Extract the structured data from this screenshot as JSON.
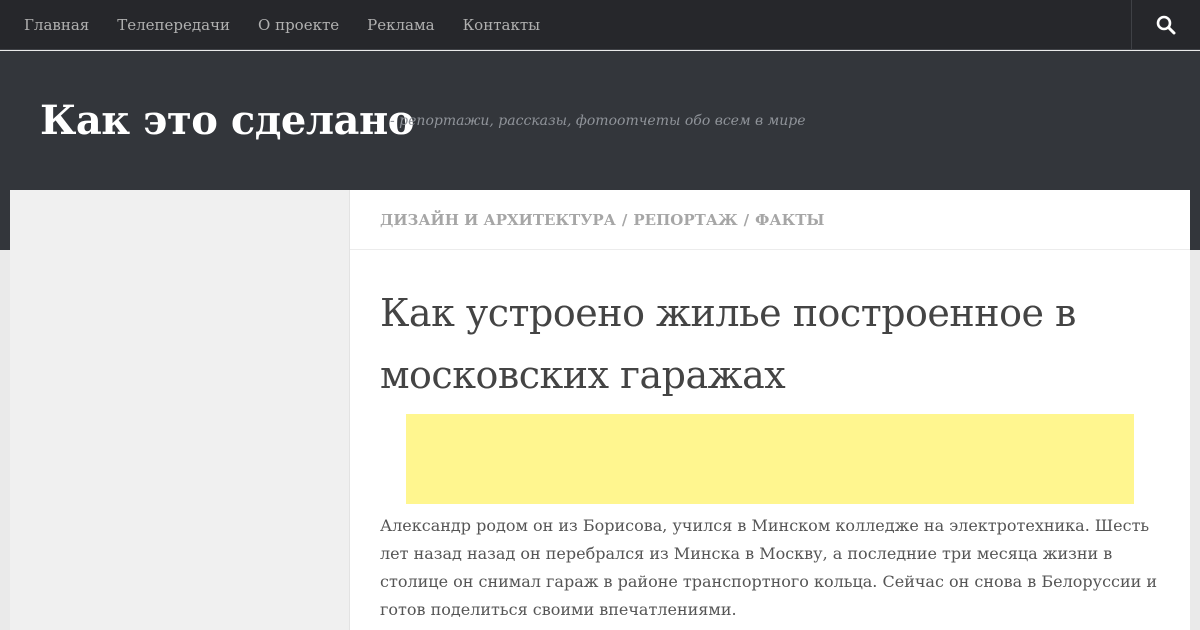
{
  "nav": {
    "items": [
      {
        "label": "Главная"
      },
      {
        "label": "Телепередачи"
      },
      {
        "label": "О проекте"
      },
      {
        "label": "Реклама"
      },
      {
        "label": "Контакты"
      }
    ],
    "search_icon": "search-icon"
  },
  "header": {
    "title": "Как это сделано",
    "tagline": "- репортажи, рассказы, фотоотчеты обо всем в мире"
  },
  "breadcrumbs": {
    "items": [
      {
        "label": "Дизайн и архитектура"
      },
      {
        "label": "Репортаж"
      },
      {
        "label": "Факты"
      }
    ],
    "separator": "/"
  },
  "post": {
    "title": "Как устроено жилье построенное в московских гаражах",
    "body": "Александр родом он из Борисова, учился в Минском колледже на электротехника. Шесть лет назад назад он перебрался из Минска в Москву, а последние три месяца жизни в столице он снимал гараж в районе транспортного кольца. Сейчас он снова в Белоруссии и готов поделиться своими впечатлениями."
  },
  "colors": {
    "nav_bg": "#26272b",
    "header_bg": "#33363b",
    "ad_bg": "#fff68f"
  }
}
